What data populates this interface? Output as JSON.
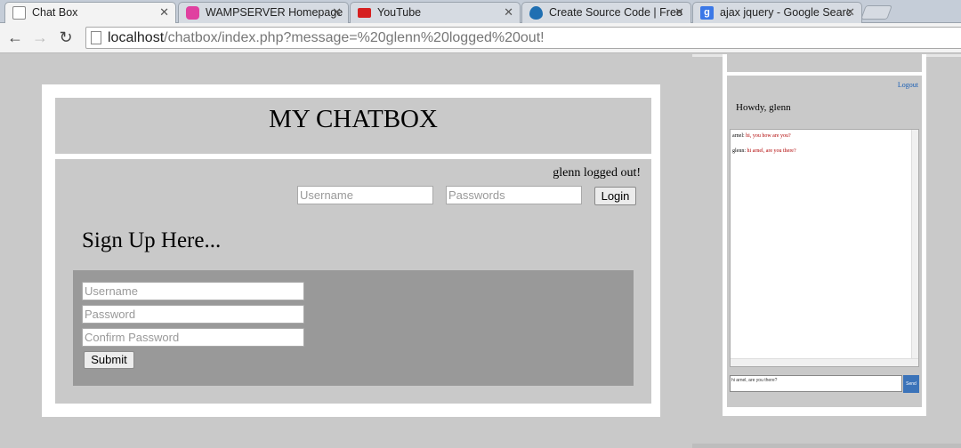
{
  "browser": {
    "tabs": [
      {
        "title": "Chat Box",
        "icon": "page-icon",
        "color": "#ffffff"
      },
      {
        "title": "WAMPSERVER Homepage",
        "icon": "wamp-icon",
        "color": "#e040a0"
      },
      {
        "title": "YouTube",
        "icon": "youtube-icon",
        "color": "#d62020"
      },
      {
        "title": "Create Source Code | Free",
        "icon": "drupal-icon",
        "color": "#1f6fb2"
      },
      {
        "title": "ajax jquery - Google Searc",
        "icon": "google-icon",
        "color": "#3b78e7"
      }
    ],
    "url_host": "localhost",
    "url_path": "/chatbox/index.php?message=%20glenn%20logged%20out!"
  },
  "page": {
    "title": "MY CHATBOX",
    "status_message": "glenn logged out!",
    "login": {
      "username_placeholder": "Username",
      "password_placeholder": "Passwords",
      "login_label": "Login"
    },
    "signup": {
      "heading": "Sign Up Here...",
      "username_placeholder": "Username",
      "password_placeholder": "Password",
      "confirm_placeholder": "Confirm Password",
      "submit_label": "Submit"
    }
  },
  "chat_widget": {
    "logout_label": "Logout",
    "greeting": "Howdy, glenn",
    "messages": [
      {
        "sender": "arnel:",
        "text": "hi, you how are you?"
      },
      {
        "sender": "glenn:",
        "text": "hi arnel, are you there?"
      }
    ],
    "input_value": "hi arnel, are you there?",
    "send_label": "Send"
  }
}
